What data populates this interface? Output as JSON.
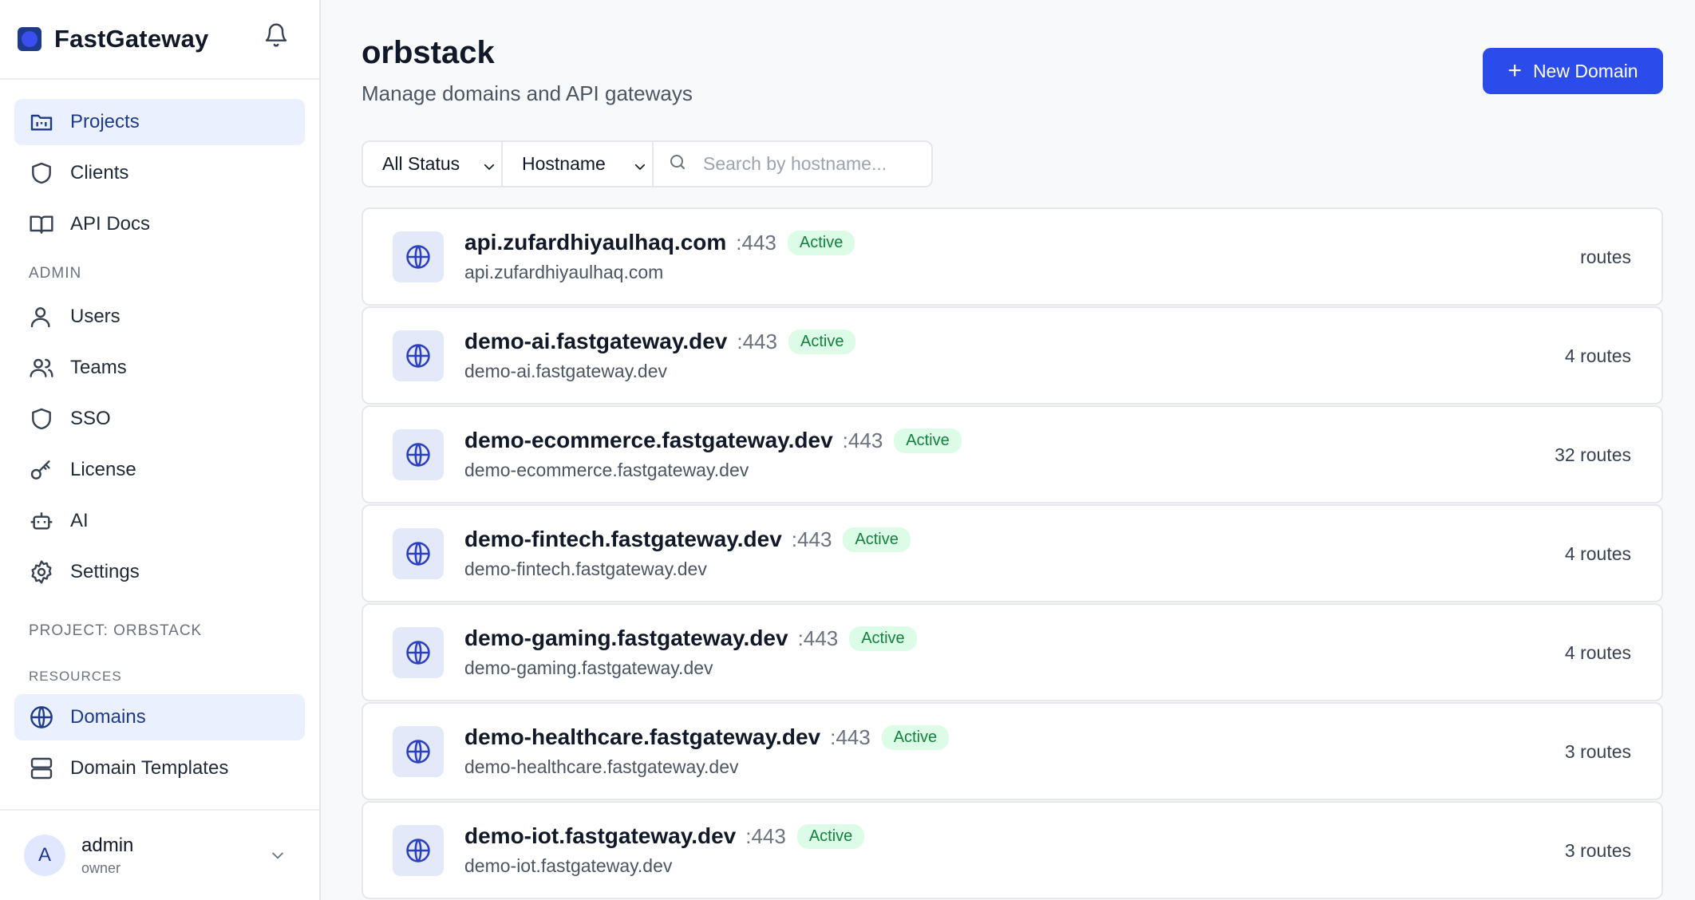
{
  "brand": {
    "name": "FastGateway"
  },
  "sidebar": {
    "main_items": [
      {
        "label": "Projects",
        "icon": "folder-icon",
        "active": true
      },
      {
        "label": "Clients",
        "icon": "shield-icon",
        "active": false
      },
      {
        "label": "API Docs",
        "icon": "book-icon",
        "active": false
      }
    ],
    "admin_label": "ADMIN",
    "admin_items": [
      {
        "label": "Users",
        "icon": "user-icon"
      },
      {
        "label": "Teams",
        "icon": "users-icon"
      },
      {
        "label": "SSO",
        "icon": "shield-icon"
      },
      {
        "label": "License",
        "icon": "key-icon"
      },
      {
        "label": "AI",
        "icon": "bot-icon"
      },
      {
        "label": "Settings",
        "icon": "gear-icon"
      }
    ],
    "project_label": "PROJECT: ORBSTACK",
    "resources_label": "RESOURCES",
    "resource_items": [
      {
        "label": "Domains",
        "icon": "globe-icon",
        "active": true
      },
      {
        "label": "Domain Templates",
        "icon": "server-icon",
        "active": false
      }
    ],
    "user": {
      "initial": "A",
      "name": "admin",
      "role": "owner"
    }
  },
  "header": {
    "title": "orbstack",
    "subtitle": "Manage domains and API gateways",
    "new_button_label": "New Domain"
  },
  "filters": {
    "status_selected": "All Status",
    "field_selected": "Hostname",
    "search_placeholder": "Search by hostname...",
    "search_value": ""
  },
  "colors": {
    "accent": "#2b4bea",
    "active_nav_bg": "#eaf0fd",
    "badge_bg": "#dcfce7",
    "badge_text": "#15803d"
  },
  "domains": [
    {
      "host": "api.zufardhiyaulhaq.com",
      "port": ":443",
      "status": "Active",
      "sub": "api.zufardhiyaulhaq.com",
      "routes": "routes"
    },
    {
      "host": "demo-ai.fastgateway.dev",
      "port": ":443",
      "status": "Active",
      "sub": "demo-ai.fastgateway.dev",
      "routes": "4 routes"
    },
    {
      "host": "demo-ecommerce.fastgateway.dev",
      "port": ":443",
      "status": "Active",
      "sub": "demo-ecommerce.fastgateway.dev",
      "routes": "32 routes"
    },
    {
      "host": "demo-fintech.fastgateway.dev",
      "port": ":443",
      "status": "Active",
      "sub": "demo-fintech.fastgateway.dev",
      "routes": "4 routes"
    },
    {
      "host": "demo-gaming.fastgateway.dev",
      "port": ":443",
      "status": "Active",
      "sub": "demo-gaming.fastgateway.dev",
      "routes": "4 routes"
    },
    {
      "host": "demo-healthcare.fastgateway.dev",
      "port": ":443",
      "status": "Active",
      "sub": "demo-healthcare.fastgateway.dev",
      "routes": "3 routes"
    },
    {
      "host": "demo-iot.fastgateway.dev",
      "port": ":443",
      "status": "Active",
      "sub": "demo-iot.fastgateway.dev",
      "routes": "3 routes"
    }
  ]
}
